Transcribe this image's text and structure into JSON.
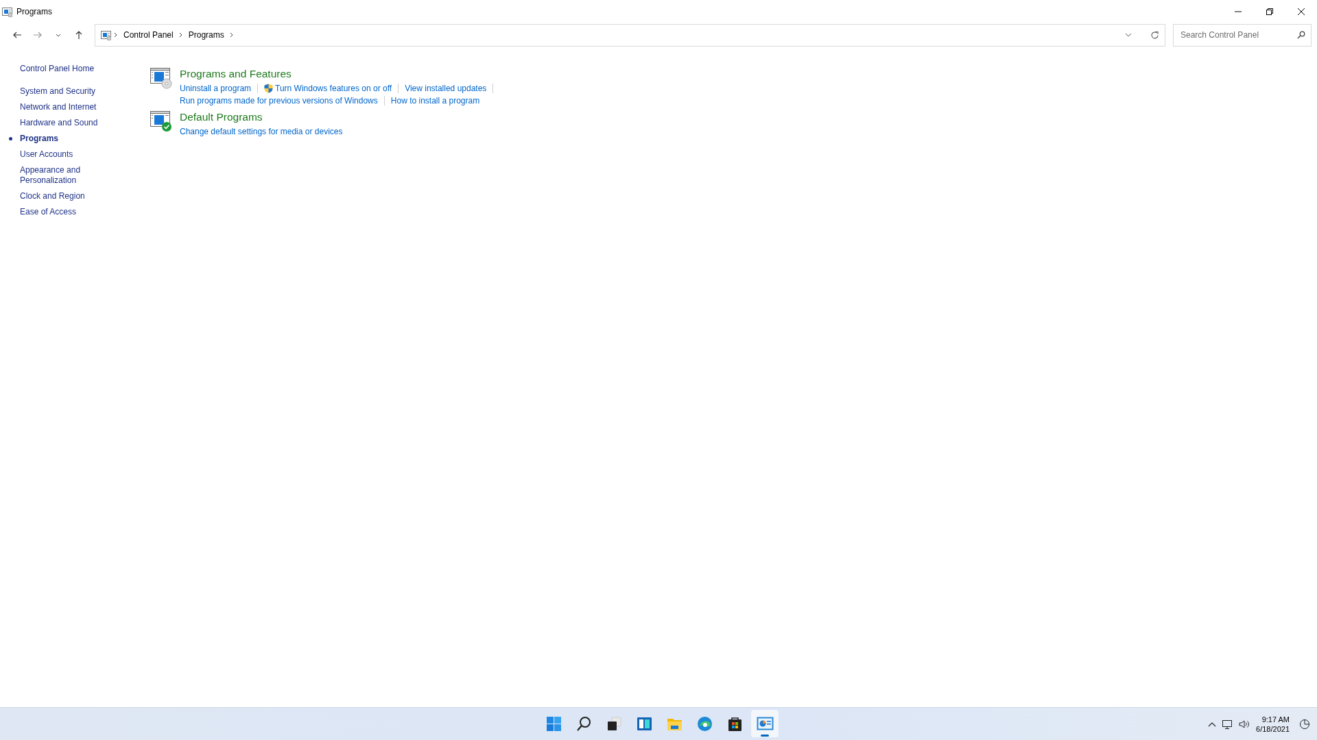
{
  "window": {
    "title": "Programs"
  },
  "address": {
    "crumbs": [
      "Control Panel",
      "Programs"
    ]
  },
  "search": {
    "placeholder": "Search Control Panel"
  },
  "sidebar": {
    "home": "Control Panel Home",
    "items": [
      {
        "label": "System and Security",
        "selected": false
      },
      {
        "label": "Network and Internet",
        "selected": false
      },
      {
        "label": "Hardware and Sound",
        "selected": false
      },
      {
        "label": "Programs",
        "selected": true
      },
      {
        "label": "User Accounts",
        "selected": false
      },
      {
        "label": "Appearance and Personalization",
        "selected": false
      },
      {
        "label": "Clock and Region",
        "selected": false
      },
      {
        "label": "Ease of Access",
        "selected": false
      }
    ]
  },
  "categories": [
    {
      "kind": "features",
      "title": "Programs and Features",
      "lines": [
        [
          {
            "label": "Uninstall a program",
            "shield": false
          },
          {
            "label": "Turn Windows features on or off",
            "shield": true
          },
          {
            "label": "View installed updates",
            "shield": false
          }
        ],
        [
          {
            "label": "Run programs made for previous versions of Windows",
            "shield": false
          },
          {
            "label": "How to install a program",
            "shield": false
          }
        ]
      ]
    },
    {
      "kind": "defaults",
      "title": "Default Programs",
      "lines": [
        [
          {
            "label": "Change default settings for media or devices",
            "shield": false
          }
        ]
      ]
    }
  ],
  "taskbar": {
    "apps": [
      {
        "kind": "start",
        "selected": false
      },
      {
        "kind": "search",
        "selected": false
      },
      {
        "kind": "taskview",
        "selected": false
      },
      {
        "kind": "widgets",
        "selected": false
      },
      {
        "kind": "explorer",
        "selected": false
      },
      {
        "kind": "edge",
        "selected": false
      },
      {
        "kind": "store",
        "selected": false
      },
      {
        "kind": "controlpanel",
        "selected": true
      }
    ],
    "time": "9:17 AM",
    "date": "6/18/2021"
  }
}
